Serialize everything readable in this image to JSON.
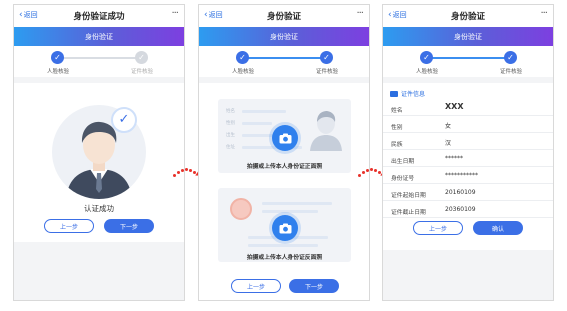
{
  "common": {
    "back_label": "返回",
    "more_glyph": "···",
    "step1_label": "人脸核验",
    "step2_label": "证件核验",
    "check_glyph": "✓"
  },
  "screen1": {
    "nav_title": "身份验证成功",
    "banner": "身份验证",
    "status": "认证成功",
    "prev_button": "上一步",
    "next_button": "下一步"
  },
  "screen2": {
    "nav_title": "身份验证",
    "banner": "身份验证",
    "front_upload": "拍摄或上传本人身份证正面照",
    "back_upload": "拍摄或上传本人身份证反面照",
    "card_keys": [
      "姓名",
      "性别",
      "出生",
      "住址"
    ],
    "prev_button": "上一步",
    "next_button": "下一步"
  },
  "screen3": {
    "nav_title": "身份验证",
    "banner": "身份验证",
    "section_title": "证件信息",
    "rows": [
      {
        "label": "姓名",
        "value": "XXX"
      },
      {
        "label": "性别",
        "value": "女"
      },
      {
        "label": "民族",
        "value": "汉"
      },
      {
        "label": "出生日期",
        "value": "******"
      },
      {
        "label": "身份证号",
        "value": "***********"
      },
      {
        "label": "证件起始日期",
        "value": "20160109"
      },
      {
        "label": "证件截止日期",
        "value": "20360109"
      }
    ],
    "prev_button": "上一步",
    "confirm_button": "确认"
  },
  "colors": {
    "accent": "#3b6fe6",
    "banner_start": "#2d9cf0",
    "banner_end": "#7d3fe0",
    "arrow": "#e8322b"
  }
}
